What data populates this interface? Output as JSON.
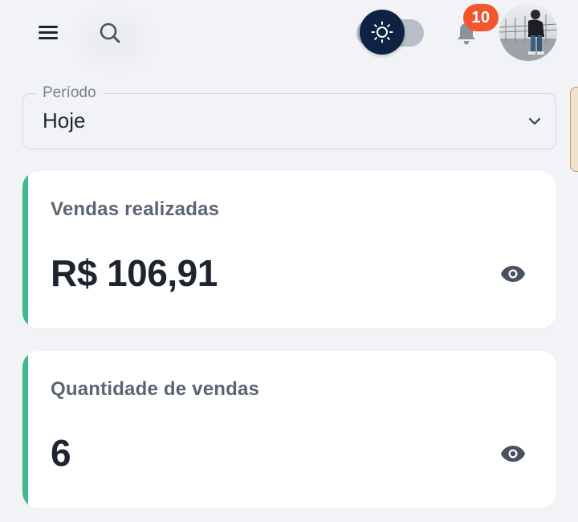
{
  "header": {
    "menu_icon": "hamburger-menu-icon",
    "search_icon": "search-icon",
    "theme_toggle_icon": "sun-icon",
    "notifications": {
      "icon": "bell-icon",
      "count": "10",
      "badge_color": "#f3552c"
    },
    "avatar": "profile-avatar"
  },
  "filter": {
    "label": "Período",
    "value": "Hoje",
    "icon": "chevron-down-icon"
  },
  "cards": [
    {
      "title": "Vendas realizadas",
      "value": "R$ 106,91",
      "icon": "eye-icon"
    },
    {
      "title": "Quantidade de vendas",
      "value": "6",
      "icon": "eye-icon"
    }
  ],
  "colors": {
    "background": "#f1f3f6",
    "accent": "#3fb88a",
    "toggle_thumb": "#0e2343",
    "toggle_track": "#b7bec9",
    "text_primary": "#1f2530",
    "text_secondary": "#5b6472"
  }
}
